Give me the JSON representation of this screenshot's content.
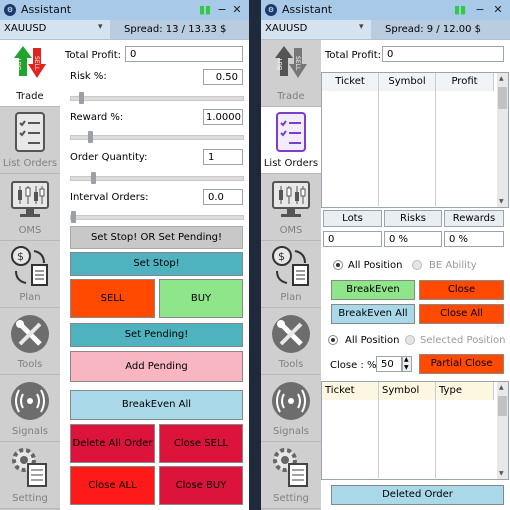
{
  "colors": {
    "title_bar": "#a9c9e8",
    "teal": "#4fb3bf",
    "orange_red": "#ff4a00",
    "light_green": "#8fe58a",
    "pink": "#f7b6c2",
    "light_blue": "#a9d8e8",
    "crimson": "#dc143c",
    "red": "#ff1a1a",
    "gray_bar": "#c8c8c8"
  },
  "window": {
    "title": "Assistant",
    "minimize_glyph": "−",
    "close_glyph": "✕",
    "status_icon": "green-chart-icon"
  },
  "sidebar": {
    "items": [
      {
        "label": "Trade",
        "icon": "buy-sell-arrows-icon"
      },
      {
        "label": "List Orders",
        "icon": "checklist-icon"
      },
      {
        "label": "OMS",
        "icon": "candlestick-monitor-icon"
      },
      {
        "label": "Plan",
        "icon": "dollar-exchange-icon"
      },
      {
        "label": "Tools",
        "icon": "wrench-screwdriver-icon"
      },
      {
        "label": "Signals",
        "icon": "broadcast-icon"
      },
      {
        "label": "Setting",
        "icon": "settings-gear-icon"
      }
    ]
  },
  "left_panel": {
    "symbol": "XAUUSD",
    "spread": "Spread: 13  / 13.33 $",
    "total_profit_label": "Total Profit:",
    "total_profit_value": "0",
    "risk_label": "Risk %:",
    "risk_value": "0.50",
    "risk_slider_value": 0.05,
    "reward_label": "Reward %:",
    "reward_value": "1.0000",
    "reward_slider_value": 0.1,
    "qty_label": "Order Quantity:",
    "qty_value": "1",
    "qty_slider_value": 0.12,
    "interval_label": "Interval Orders:",
    "interval_value": "0.0",
    "interval_slider_value": 0,
    "stop_pending_banner": "Set Stop! OR Set Pending!",
    "buttons": {
      "set_stop": "Set Stop!",
      "sell": "SELL",
      "buy": "BUY",
      "set_pending": "Set Pending!",
      "add_pending": "Add Pending",
      "breakeven_all": "BreakEven All",
      "delete_all_order": "Delete All Order",
      "close_sell": "Close SELL",
      "close_all": "Close ALL",
      "close_buy": "Close BUY"
    }
  },
  "right_panel": {
    "symbol": "XAUUSD",
    "spread": "Spread: 9  / 12.00 $",
    "total_profit_label": "Total Profit:",
    "total_profit_value": "0",
    "orders_table": {
      "columns": [
        "Ticket",
        "Symbol",
        "Profit"
      ],
      "rows": []
    },
    "stats_headers": [
      "Lots",
      "Risks",
      "Rewards"
    ],
    "stats_values": [
      "0",
      "0 %",
      "0 %"
    ],
    "radio_all_position": "All Position",
    "radio_be_ability": "BE Ability",
    "buttons": {
      "breakeven": "BreakEven",
      "close": "Close",
      "breakeven_all": "BreakEven All",
      "close_all": "Close All",
      "partial_close": "Partial Close",
      "deleted_order": "Deleted Order"
    },
    "radio_all_position_2": "All Position",
    "radio_selected_position": "Selected Position",
    "close_pct_label": "Close : %",
    "close_pct_value": "50",
    "pending_table": {
      "columns": [
        "Ticket",
        "Symbol",
        "Type"
      ],
      "rows": []
    }
  }
}
